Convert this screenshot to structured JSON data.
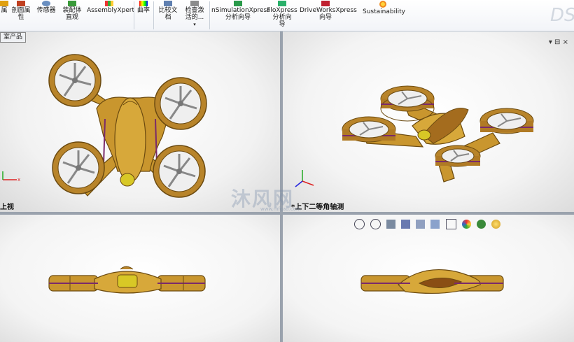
{
  "ribbon": {
    "buttons": [
      {
        "id": "b0",
        "label": "属"
      },
      {
        "id": "b1",
        "label": "剖面属\n性"
      },
      {
        "id": "b2",
        "label": "传感器"
      },
      {
        "id": "b3",
        "label": "装配体\n直观"
      },
      {
        "id": "b4",
        "label": "AssemblyXpert"
      },
      {
        "id": "b5",
        "label": "曲率"
      },
      {
        "id": "b6",
        "label": "比较文\n档"
      },
      {
        "id": "b7",
        "label": "检查激\n活的..."
      },
      {
        "id": "b8",
        "label": "nSimulationXpress\n分析向导"
      },
      {
        "id": "b9",
        "label": "FloXpress\n分析向\n导"
      },
      {
        "id": "b10",
        "label": "DriveWorksXpress\n向导"
      },
      {
        "id": "b11",
        "label": "Sustainability"
      }
    ]
  },
  "tree_tab": "室产品",
  "views": {
    "top_left": "上视",
    "top_right": "*上下二等角轴测"
  },
  "pane_controls": "▾ ⊟ ×",
  "watermark": {
    "text": "沐风网",
    "sub": "www.mfcad.com"
  },
  "colors": {
    "body": "#c9962e",
    "accent_stripe": "#7a2a6b",
    "canopy": "#d8c826"
  }
}
